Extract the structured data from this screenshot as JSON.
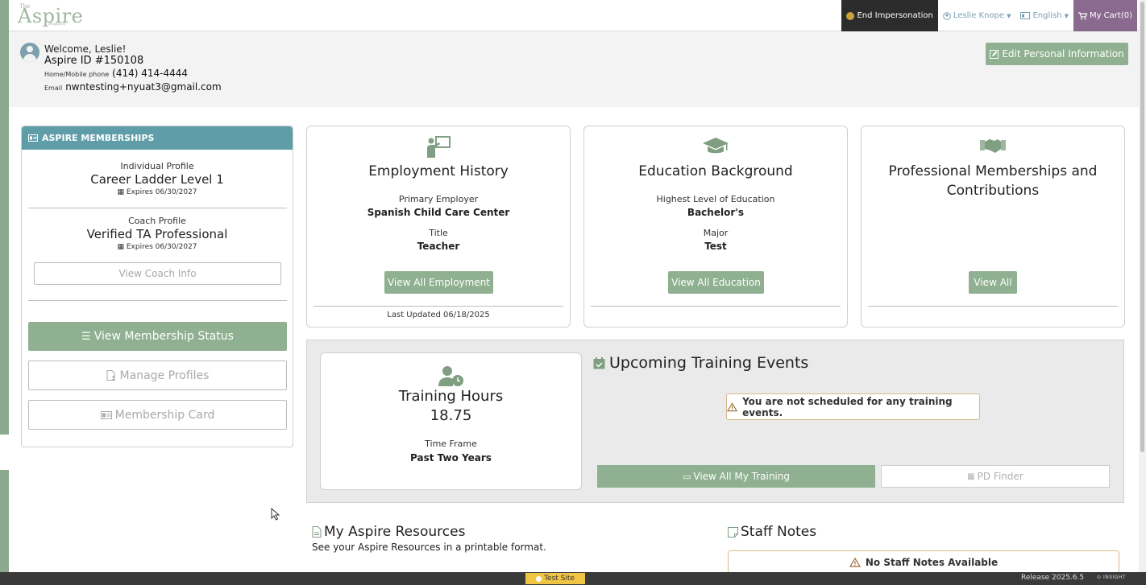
{
  "logo": {
    "the": "The",
    "name": "Aspire",
    "registry": "Registry"
  },
  "topnav": {
    "end_impersonation": "End Impersonation",
    "user": "Leslie Knope",
    "language": "English",
    "cart": "My Cart(0)"
  },
  "profile": {
    "welcome": "Welcome, Leslie!",
    "aspire_id": "Aspire ID  #150108",
    "phone_label": "Home/Mobile phone",
    "phone": "(414) 414-4444",
    "email_label": "Email",
    "email": "nwntesting+nyuat3@gmail.com",
    "edit_button": "Edit Personal Information"
  },
  "memberships": {
    "header": "ASPIRE MEMBERSHIPS",
    "individual": {
      "label": "Individual Profile",
      "level": "Career Ladder Level 1",
      "expires": "Expires 06/30/2027"
    },
    "coach": {
      "label": "Coach Profile",
      "level": "Verified TA Professional",
      "expires": "Expires 06/30/2027"
    },
    "view_coach_info": "View Coach Info",
    "view_status": "View Membership Status",
    "manage_profiles": "Manage Profiles",
    "membership_card": "Membership Card"
  },
  "employment": {
    "title": "Employment History",
    "primary_label": "Primary Employer",
    "primary_value": "Spanish Child Care Center",
    "title_label": "Title",
    "title_value": "Teacher",
    "button": "View All Employment",
    "updated": "Last Updated 06/18/2025"
  },
  "education": {
    "title": "Education Background",
    "level_label": "Highest Level of Education",
    "level_value": "Bachelor's",
    "major_label": "Major",
    "major_value": "Test",
    "button": "View All Education"
  },
  "memberships_contrib": {
    "title": "Professional Memberships and Contributions",
    "button": "View All"
  },
  "training": {
    "hours_title": "Training Hours",
    "hours_value": "18.75",
    "timeframe_label": "Time Frame",
    "timeframe_value": "Past Two Years",
    "upcoming_title": "Upcoming Training Events",
    "alert": "You are not scheduled for any training events.",
    "view_all": "View All My Training",
    "pd_finder": "PD Finder"
  },
  "resources": {
    "title": "My Aspire Resources",
    "subtitle": "See your Aspire Resources in a printable format."
  },
  "staff_notes": {
    "title": "Staff Notes",
    "alert": "No Staff Notes Available"
  },
  "footer": {
    "test_site": "Test Site",
    "release": "Release 2025.6.5",
    "insight": "INSIGHT"
  },
  "colors": {
    "brand_green": "#8fb091",
    "teal_header": "#5f9ea8",
    "alert_border": "#d8b98a",
    "cart_purple": "#8a6a8f",
    "test_site_yellow": "#f0c544"
  }
}
